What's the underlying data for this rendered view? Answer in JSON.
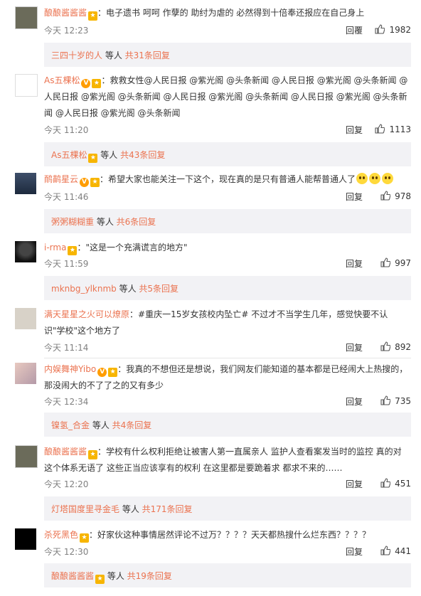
{
  "labels": {
    "reply": "回复",
    "reply_alt": "回覆",
    "others": "等人",
    "total_prefix": "共",
    "replies_suffix": "回复"
  },
  "comments": [
    {
      "user": "酿酿酱酱酱",
      "badges": [
        "gold"
      ],
      "text": "：电子遗书 呵呵 作孽的 助纣为虐的 必然得到十倍奉还报应在自己身上",
      "time": "今天 12:23",
      "reply_label": "回覆",
      "likes": "1982",
      "sub": {
        "name": "三四十岁的人",
        "badge": false,
        "others": "等人",
        "total": "共31条回复"
      }
    },
    {
      "user": "As五棵松",
      "badges": [
        "vip",
        "gold"
      ],
      "text": "：救救女性@人民日报 @紫光阁 @头条新闻 @人民日报 @紫光阁 @头条新闻 @人民日报 @紫光阁 @头条新闻 @人民日报 @紫光阁 @头条新闻 @人民日报 @紫光阁 @头条新闻 @人民日报 @紫光阁 @头条新闻",
      "time": "今天 11:20",
      "reply_label": "回复",
      "likes": "1113",
      "sub": {
        "name": "As五棵松",
        "badge": true,
        "others": "等人",
        "total": "共43条回复"
      }
    },
    {
      "user": "鸸鹋星云",
      "badges": [
        "vip",
        "gold"
      ],
      "text": "：希望大家也能关注一下这个，现在真的是只有普通人能帮普通人了",
      "time": "今天 11:46",
      "reply_label": "回复",
      "likes": "978",
      "sub": {
        "name": "粥粥糊糊重",
        "badge": false,
        "others": "等人",
        "total": "共6条回复"
      }
    },
    {
      "user": "i-rma",
      "badges": [
        "gold"
      ],
      "text": "：\"这是一个充满谎言的地方\"",
      "time": "今天 11:59",
      "reply_label": "回复",
      "likes": "997",
      "sub": {
        "name": "mknbg_ylknmb",
        "badge": false,
        "others": "等人",
        "total": "共5条回复"
      }
    },
    {
      "user": "满天星星之火可以燎原",
      "badges": [],
      "text": "：#重庆一15岁女孩校内坠亡# 不过才不当学生几年，感觉快要不认识\"学校\"这个地方了",
      "time": "今天 11:14",
      "reply_label": "回复",
      "likes": "892",
      "sub": null
    },
    {
      "user": "内娱舞神Yibo",
      "badges": [
        "vip",
        "gold"
      ],
      "text": "：我真的不想但还是想说，我们网友们能知道的基本都是已经闹大上热搜的，那没闹大的不了了之的又有多少",
      "time": "今天 12:34",
      "reply_label": "回复",
      "likes": "735",
      "sub": {
        "name": "镍氢_合金",
        "badge": false,
        "others": "等人",
        "total": "共4条回复"
      }
    },
    {
      "user": "酿酿酱酱酱",
      "badges": [
        "gold"
      ],
      "text": "：学校有什么权利拒绝让被害人第一直属亲人 监护人查看案发当时的监控 真的对这个体系无语了 这些正当应该享有的权利 在这里都是要跪着求 都求不来的……",
      "time": "今天 12:20",
      "reply_label": "回复",
      "likes": "451",
      "sub": {
        "name": "灯塔国度里寻金毛",
        "badge": false,
        "others": "等人",
        "total": "共171条回复"
      }
    },
    {
      "user": "杀死黑色",
      "badges": [
        "gold"
      ],
      "text": "：好家伙这种事情居然评论不过万？？？？天天都热搜什么烂东西？？？？",
      "time": "今天 12:30",
      "reply_label": "回复",
      "likes": "441",
      "sub": {
        "name": "酿酿酱酱酱",
        "badge": true,
        "others": "等人",
        "total": "共19条回复"
      }
    }
  ]
}
